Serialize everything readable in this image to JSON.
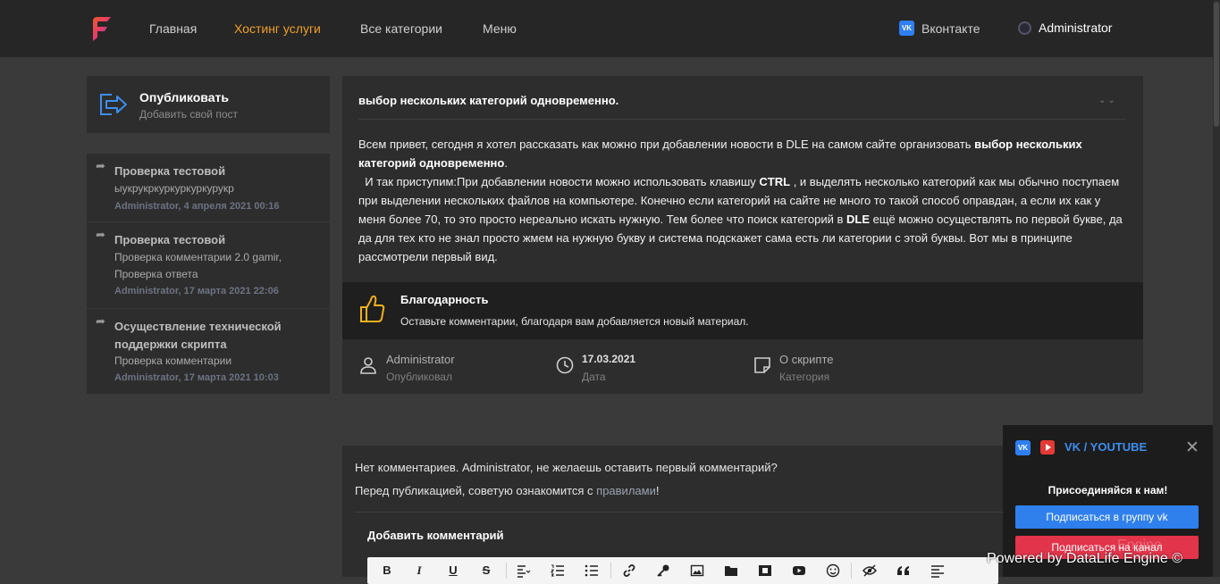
{
  "nav": {
    "items": [
      "Главная",
      "Хостинг услуги",
      "Все категории",
      "Меню"
    ],
    "vk_label": "Вконтакте",
    "vk_badge": "VK",
    "user_label": "Administrator",
    "accent": "#f0a028"
  },
  "publish": {
    "title": "Опубликовать",
    "subtitle": "Добавить свой пост"
  },
  "latest": [
    {
      "title": "Проверка тестовой",
      "sub": "ыукрукркуркуркуркурукр",
      "meta": "Administrator, 4 апреля 2021 00:16"
    },
    {
      "title": "Проверка тестовой",
      "sub": "Проверка комментарии 2.0    gamir, Проверка ответа",
      "meta": "Administrator, 17 марта 2021 22:06"
    },
    {
      "title": "Осуществление технической поддержки скрипта",
      "sub": "Проверка комментарии",
      "meta": "Administrator, 17 марта 2021 10:03"
    }
  ],
  "article": {
    "title": "выбор нескольких категорий одновременно.",
    "p1_a": "Всем привет, сегодня я хотел рассказать как можно при добавлении новости в DLE на самом сайте организовать ",
    "p1_b": "выбор нескольких категорий одновременно",
    "p1_c": ".",
    "p2_a": "И так приступим:При добавлении новости можно использовать клавишу ",
    "p2_b": "CTRL",
    "p2_c": " , и выделять несколько категорий как мы обычно    поступаем при выделении нескольких файлов на компьютере. Конечно если категорий на сайте не много то такой способ оправдан, а если их как  у меня более 70, то это просто нереально искать нужную. Тем более что поиск категорий в ",
    "p2_d": "DLE",
    "p2_e": "  ещё можно осуществлять по первой букве, да да для тех кто не знал просто жмем на нужную букву и система подскажет сама есть ли категории с этой буквы. Вот мы в принципе рассмотрели первый вид."
  },
  "thanks": {
    "title": "Благодарность",
    "text": "Оставьте комментарии, благодаря вам добавляется новый материал."
  },
  "meta": {
    "author": "Administrator",
    "author_label": "Опубликовал",
    "date": "17.03.2021",
    "date_label": "Дата",
    "category": "О скрипте",
    "category_label": "Категория"
  },
  "comments": {
    "none_text": "Нет комментариев. Administrator, не желаешь оставить первый комментарий?",
    "rules_prefix": "Перед публикацией, советую ознакомится с ",
    "rules_link": "правилами",
    "rules_suffix": "!",
    "add_title": "Добавить комментарий"
  },
  "editor_tools": [
    "B",
    "I",
    "U",
    "S"
  ],
  "vkbox": {
    "title": "VK / YOUTUBE",
    "vk_badge": "VK",
    "close": "✕",
    "join": "Присоединяйся к нам!",
    "btn_vk": "Подписаться в группу vk",
    "btn_yt": "Подписаться на канал"
  },
  "footer": {
    "powered": "Powered by DataLife Engine ©",
    "watermark": "Engine"
  }
}
